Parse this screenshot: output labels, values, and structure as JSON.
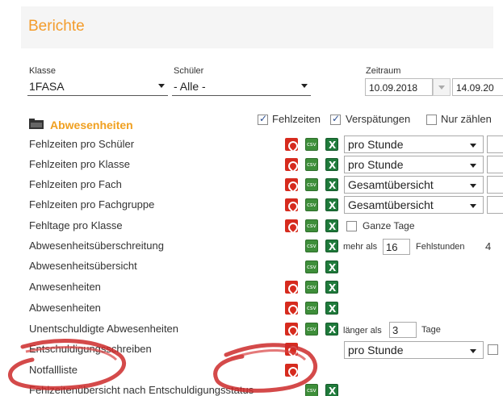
{
  "header": {
    "title": "Berichte"
  },
  "filters": {
    "klasse": {
      "label": "Klasse",
      "value": "1FASA"
    },
    "schueler": {
      "label": "Schüler",
      "value": "- Alle -"
    },
    "zeitraum": {
      "label": "Zeitraum",
      "from": "10.09.2018",
      "to": "14.09.20"
    }
  },
  "section": {
    "title": "Abwesenheiten",
    "options": [
      {
        "label": "Fehlzeiten",
        "checked": true
      },
      {
        "label": "Verspätungen",
        "checked": true
      },
      {
        "label": "Nur zählen",
        "checked": false
      }
    ]
  },
  "rows": [
    {
      "label": "Fehlzeiten pro Schüler",
      "pdf": true,
      "csv": true,
      "xls": true,
      "select": "pro Stunde"
    },
    {
      "label": "Fehlzeiten pro Klasse",
      "pdf": true,
      "csv": true,
      "xls": true,
      "select": "pro Stunde"
    },
    {
      "label": "Fehlzeiten pro Fach",
      "pdf": true,
      "csv": true,
      "xls": true,
      "select": "Gesamtübersicht"
    },
    {
      "label": "Fehlzeiten pro Fachgruppe",
      "pdf": true,
      "csv": true,
      "xls": true,
      "select": "Gesamtübersicht"
    },
    {
      "label": "Fehltage pro Klasse",
      "pdf": true,
      "csv": true,
      "xls": true,
      "checkbox": "Ganze Tage"
    },
    {
      "label": "Abwesenheitsüberschreitung",
      "pdf": false,
      "csv": true,
      "xls": true,
      "prefix": "mehr als",
      "number": "16",
      "suffix": "Fehlstunden",
      "extra": "4"
    },
    {
      "label": "Abwesenheitsübersicht",
      "pdf": false,
      "csv": true,
      "xls": true
    },
    {
      "label": "Anwesenheiten",
      "pdf": true,
      "csv": true,
      "xls": true
    },
    {
      "label": "Abwesenheiten",
      "pdf": true,
      "csv": true,
      "xls": true
    },
    {
      "label": "Unentschuldigte Abwesenheiten",
      "pdf": true,
      "csv": true,
      "xls": true,
      "prefix": "länger als",
      "number": "3",
      "suffix": "Tage"
    },
    {
      "label": "Entschuldigungsschreiben",
      "pdf": true,
      "csv": false,
      "xls": false,
      "select": "pro Stunde"
    },
    {
      "label": "Notfallliste",
      "pdf": true,
      "csv": false,
      "xls": false
    },
    {
      "label": "Fehlzeitenübersicht nach Entschuldigungsstatus",
      "pdf": false,
      "csv": true,
      "xls": true
    }
  ]
}
